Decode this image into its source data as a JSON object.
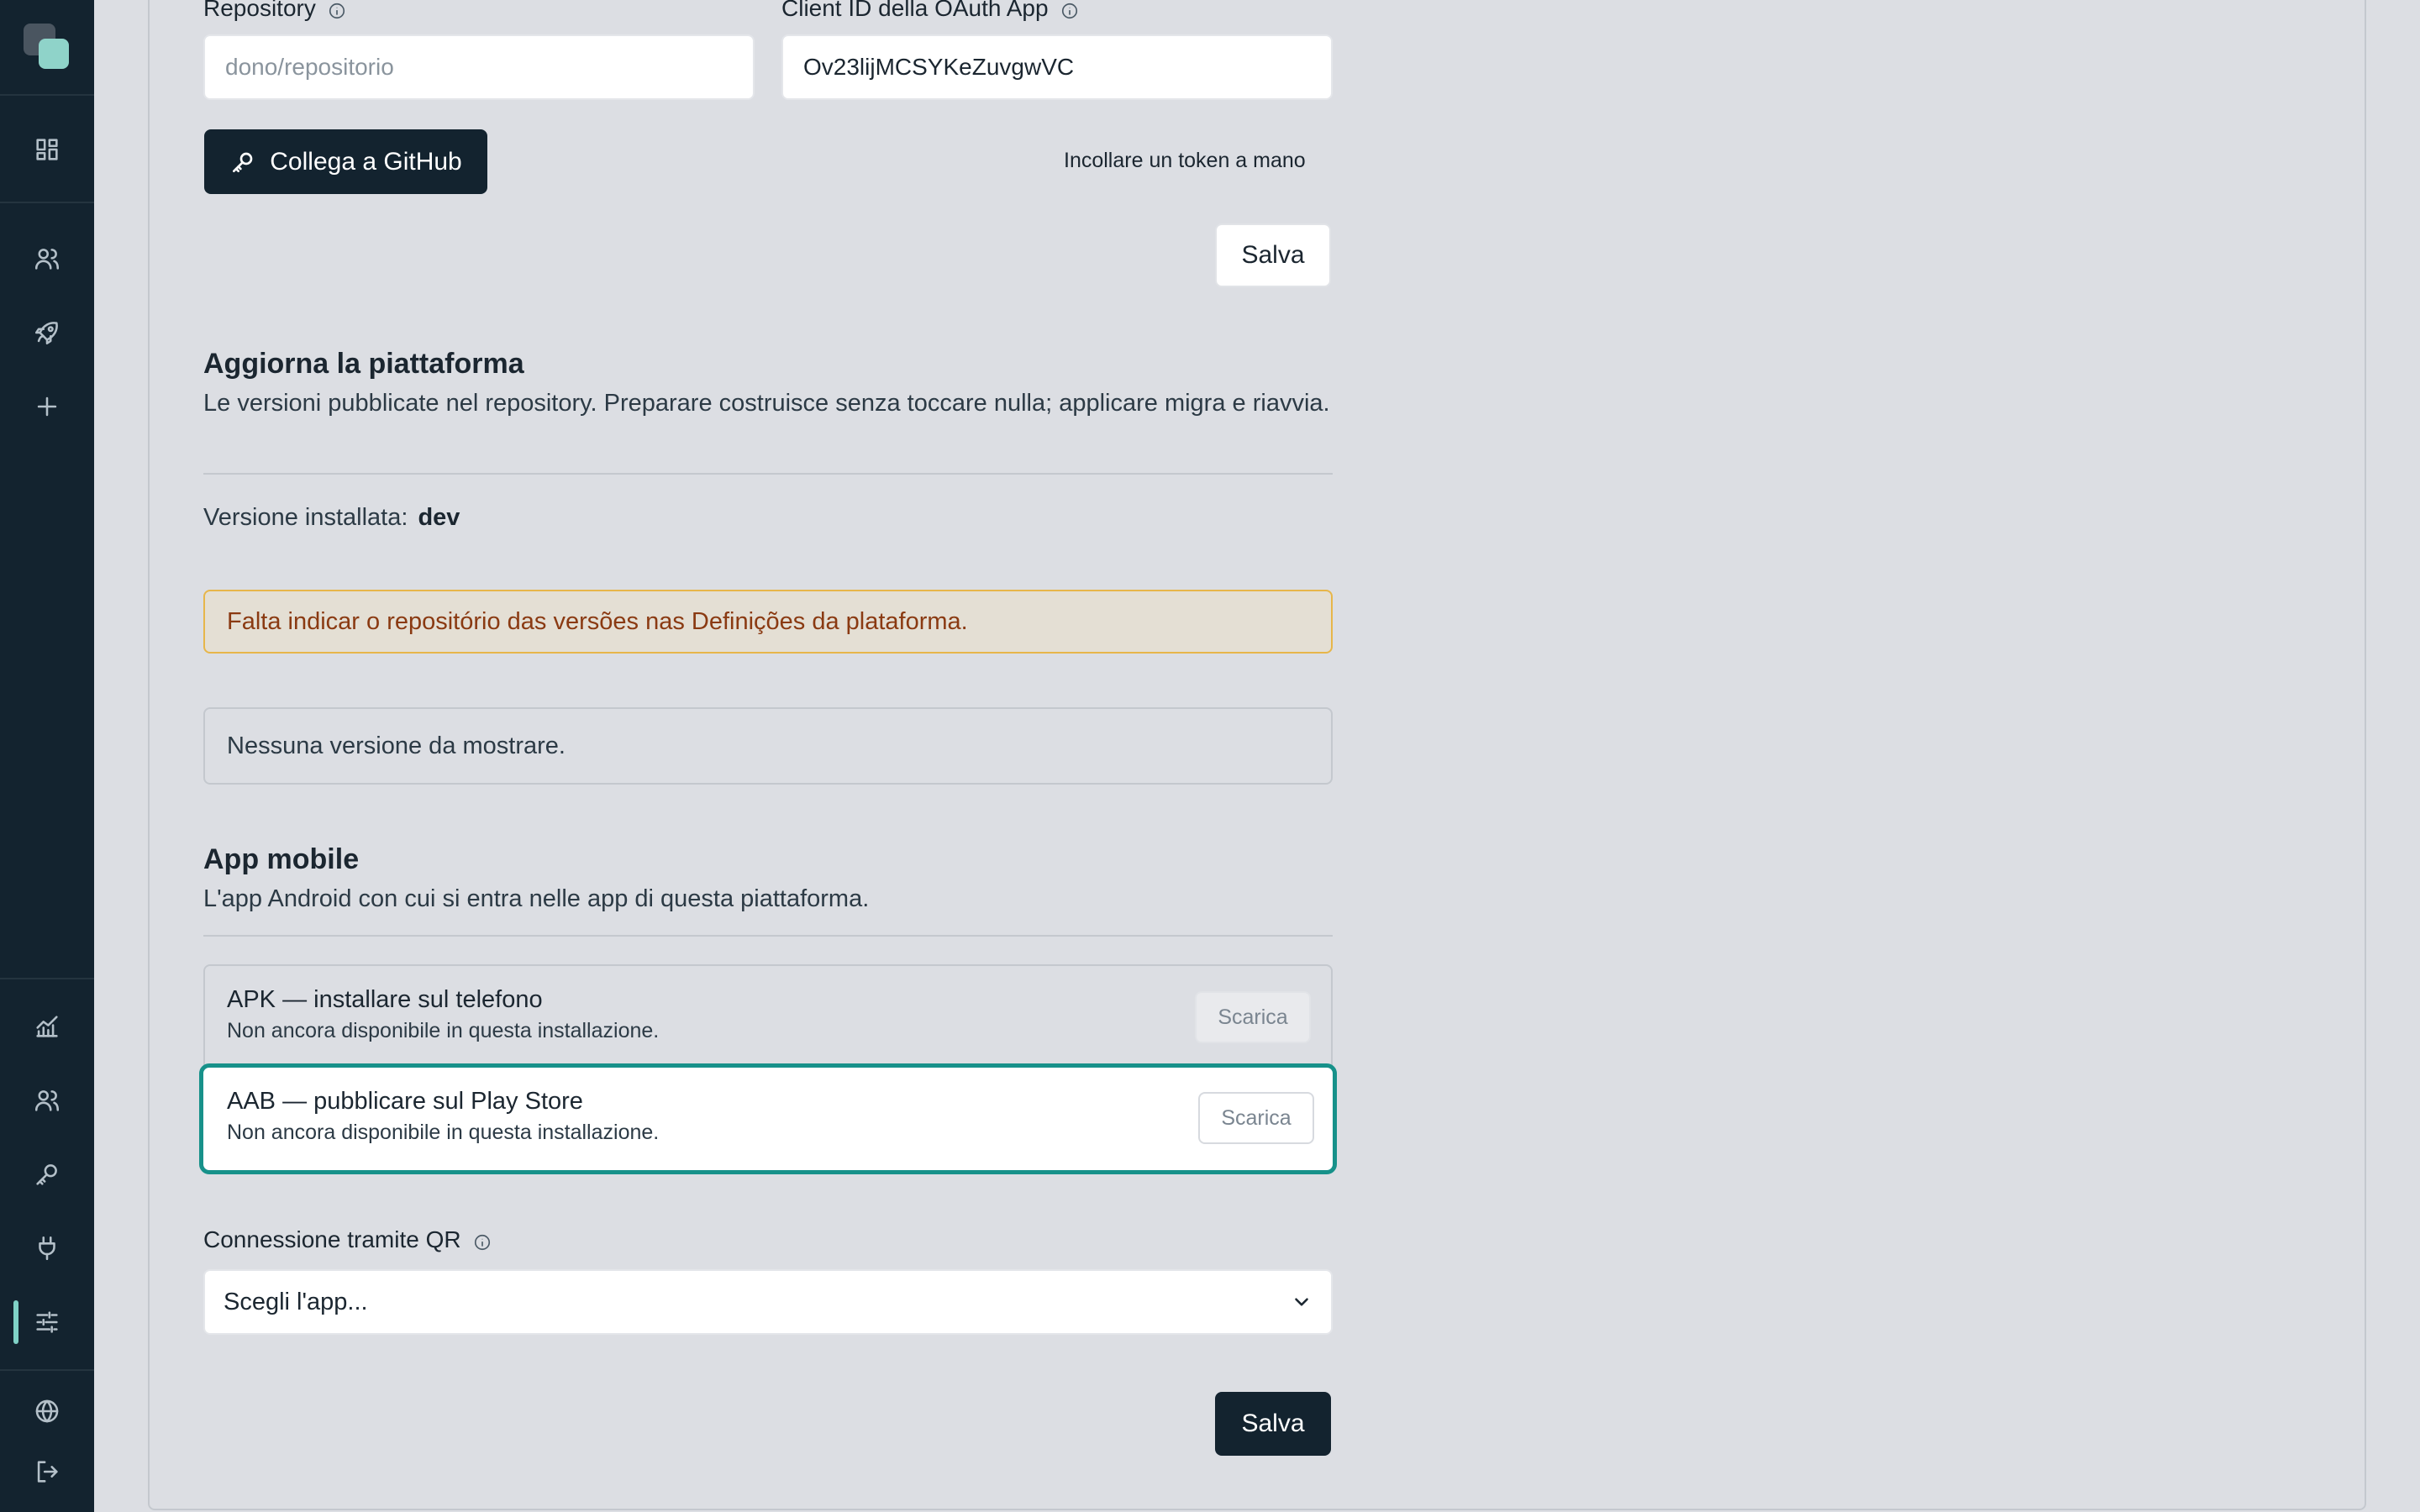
{
  "sidebar": {
    "logo": "app-logo",
    "top_icons": [
      "dashboard-icon",
      "users-icon",
      "rocket-icon",
      "plus-icon"
    ],
    "bottom_icons": [
      "analytics-icon",
      "team-icon",
      "key-icon",
      "plug-icon",
      "sliders-icon",
      "globe-icon",
      "logout-icon"
    ],
    "active_item": "sliders-icon",
    "accent_color": "#7fd1c6"
  },
  "github": {
    "repository_label": "Repository",
    "repository_placeholder": "dono/repositorio",
    "client_id_label": "Client ID della OAuth App",
    "client_id_value": "Ov23lijMCSYKeZuvgwVC",
    "connect_button": "Collega a GitHub",
    "paste_token_link": "Incollare un token a mano",
    "save_button": "Salva"
  },
  "update": {
    "title": "Aggiorna la piattaforma",
    "description": "Le versioni pubblicate nel repository. Preparare costruisce senza toccare nulla; applicare migra e riavvia.",
    "installed_label": "Versione installata:",
    "installed_value": "dev",
    "warning": "Falta indicar o repositório das versões nas Definições da plataforma.",
    "empty": "Nessuna versione da mostrare."
  },
  "mobile": {
    "title": "App mobile",
    "description": "L'app Android con cui si entra nelle app di questa piattaforma.",
    "apk_title": "APK — installare sul telefono",
    "apk_sub": "Non ancora disponibile in questa installazione.",
    "apk_button": "Scarica",
    "aab_title": "AAB — pubblicare sul Play Store",
    "aab_sub": "Non ancora disponibile in questa installazione.",
    "aab_button": "Scarica",
    "qr_label": "Connessione tramite QR",
    "qr_select": "Scegli l'app...",
    "save_button": "Salva",
    "highlight_color": "#17918a",
    "warning_border": "#e7b64a"
  }
}
